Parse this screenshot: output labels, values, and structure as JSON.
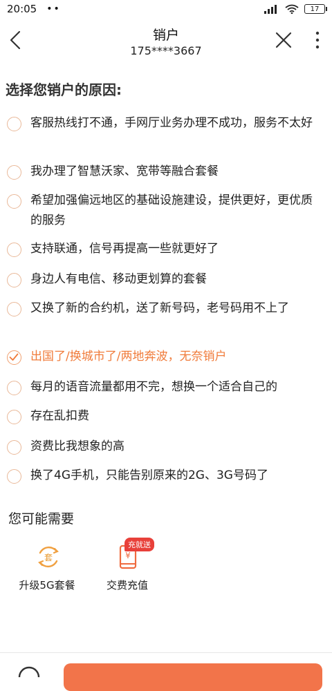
{
  "status": {
    "time": "20:05",
    "dots": "••",
    "battery": "17"
  },
  "header": {
    "title": "销户",
    "phone": "175****3667"
  },
  "section_title": "选择您销户的原因:",
  "reasons": [
    {
      "text": "客服热线打不通，手网厅业务办理不成功，服务不太好",
      "selected": false
    },
    {
      "text": "我办理了智慧沃家、宽带等融合套餐",
      "selected": false
    },
    {
      "text": "希望加强偏远地区的基础设施建设，提供更好，更优质的服务",
      "selected": false
    },
    {
      "text": "支持联通，信号再提高一些就更好了",
      "selected": false
    },
    {
      "text": "身边人有电信、移动更划算的套餐",
      "selected": false
    },
    {
      "text": "又换了新的合约机，送了新号码，老号码用不上了",
      "selected": false
    },
    {
      "text": "出国了/换城市了/两地奔波，无奈销户",
      "selected": true
    },
    {
      "text": "每月的语音流量都用不完，想换一个适合自己的",
      "selected": false
    },
    {
      "text": "存在乱扣费",
      "selected": false
    },
    {
      "text": "资费比我想象的高",
      "selected": false
    },
    {
      "text": "换了4G手机，只能告别原来的2G、3G号码了",
      "selected": false
    }
  ],
  "maybe_title": "您可能需要",
  "services": [
    {
      "label": "升级5G套餐",
      "icon": "package-upgrade-icon"
    },
    {
      "label": "交费充值",
      "icon": "phone-recharge-icon",
      "badge": "充就送"
    }
  ],
  "colors": {
    "accent": "#f07b3a",
    "radio_border": "#e9b898",
    "button": "#f2744a",
    "badge": "#e8403a"
  }
}
